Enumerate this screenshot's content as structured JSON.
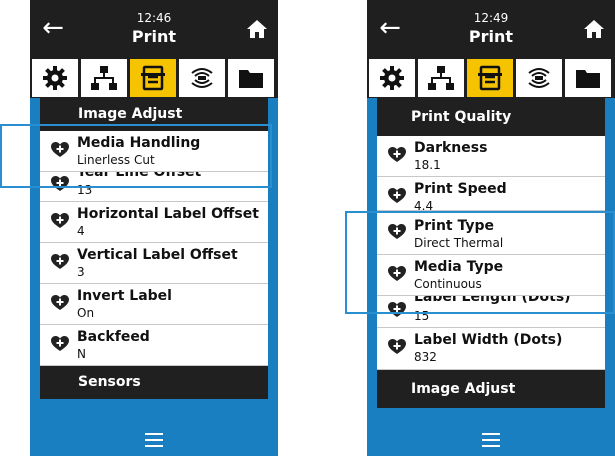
{
  "icons": {
    "back": "left-arrow-icon",
    "home": "home-icon",
    "tabs": [
      "gear-icon",
      "network-icon",
      "printer-icon",
      "wireless-icon",
      "folder-icon"
    ],
    "favorite": "heart-plus-icon",
    "menu": "hamburger-menu-icon"
  },
  "colors": {
    "topbar": "#1f1f1f",
    "active_tab": "#f6c300",
    "background_blue": "#1a7fc0",
    "highlight_border": "#2a8fd0"
  },
  "screens": [
    {
      "time": "12:46",
      "title": "Print",
      "header": "Image Adjust",
      "items": [
        {
          "label": "Media Handling",
          "value": "Linerless Cut"
        },
        {
          "label": "Tear Line Offset",
          "value": "13"
        },
        {
          "label": "Horizontal Label Offset",
          "value": "4"
        },
        {
          "label": "Vertical Label Offset",
          "value": "3"
        },
        {
          "label": "Invert Label",
          "value": "On"
        },
        {
          "label": "Backfeed",
          "value": "N"
        }
      ],
      "footer_section": "Sensors"
    },
    {
      "time": "12:49",
      "title": "Print",
      "header": "Print Quality",
      "items": [
        {
          "label": "Darkness",
          "value": "18.1"
        },
        {
          "label": "Print Speed",
          "value": "4.4"
        },
        {
          "label": "Print Type",
          "value": "Direct Thermal"
        },
        {
          "label": "Media Type",
          "value": "Continuous"
        },
        {
          "label": "Label Length (Dots)",
          "value": "15"
        },
        {
          "label": "Label Width (Dots)",
          "value": "832"
        }
      ],
      "footer_section": "Image Adjust"
    }
  ]
}
